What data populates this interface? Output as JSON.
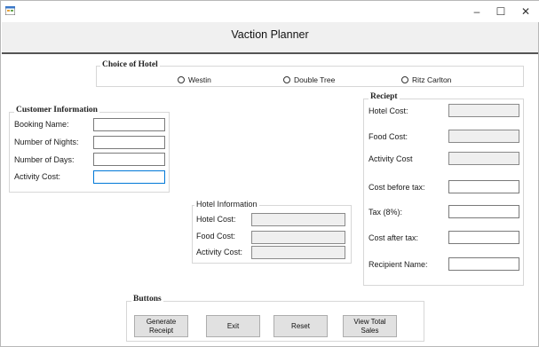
{
  "window": {
    "title": "Vaction Planner",
    "controls": {
      "minimize": "–",
      "maximize": "☐",
      "close": "✕"
    }
  },
  "hotel_choice": {
    "legend": "Choice of Hotel",
    "options": [
      "Westin",
      "Double Tree",
      "Ritz Carlton"
    ]
  },
  "customer": {
    "legend": "Customer Information",
    "fields": [
      {
        "label": "Booking Name:",
        "value": ""
      },
      {
        "label": "Number of Nights:",
        "value": ""
      },
      {
        "label": "Number of Days:",
        "value": ""
      },
      {
        "label": "Activity Cost:",
        "value": ""
      }
    ]
  },
  "hotel_info": {
    "legend": "Hotel Information",
    "fields": [
      {
        "label": "Hotel Cost:",
        "value": ""
      },
      {
        "label": "Food Cost:",
        "value": ""
      },
      {
        "label": "Activity Cost:",
        "value": ""
      }
    ]
  },
  "receipt": {
    "legend": "Reciept",
    "fields": [
      {
        "label": "Hotel Cost:",
        "value": ""
      },
      {
        "label": "Food Cost:",
        "value": ""
      },
      {
        "label": "Activity Cost",
        "value": ""
      },
      {
        "label": "Cost before tax:",
        "value": ""
      },
      {
        "label": "Tax (8%):",
        "value": ""
      },
      {
        "label": "Cost after tax:",
        "value": ""
      },
      {
        "label": "Recipient Name:",
        "value": ""
      }
    ]
  },
  "buttons": {
    "legend": "Buttons",
    "generate_line1": "Generate",
    "generate_line2": "Receipt",
    "exit": "Exit",
    "reset": "Reset",
    "view_line1": "View Total",
    "view_line2": "Sales"
  },
  "colors": {
    "accent_focus": "#0078d7",
    "header_band": "#f0f0f0",
    "separator": "#555555"
  }
}
